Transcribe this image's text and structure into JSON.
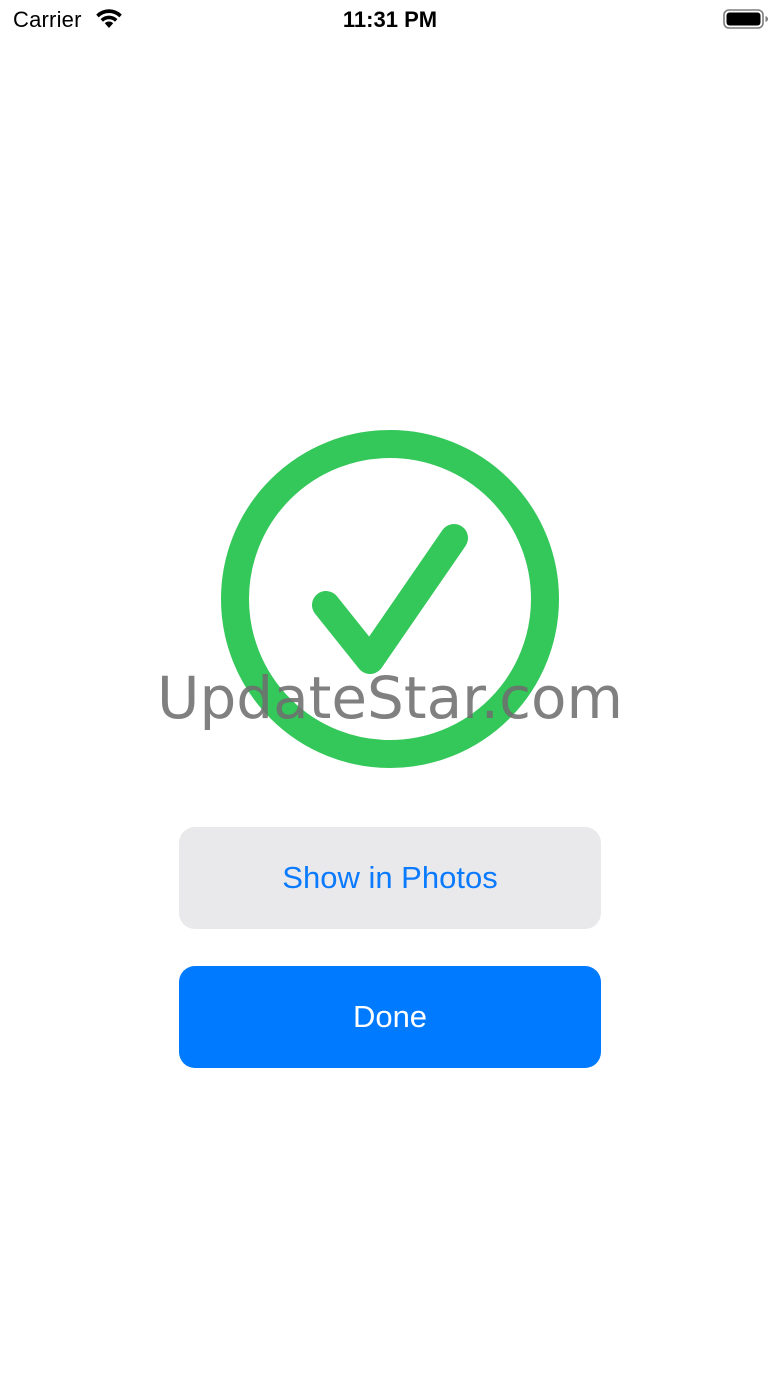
{
  "status_bar": {
    "carrier": "Carrier",
    "time": "11:31 PM",
    "icons": [
      "wifi-icon",
      "battery-icon"
    ]
  },
  "success": {
    "icon": "checkmark-circle-icon",
    "color": "#34c759"
  },
  "watermark": {
    "text": "UpdateStar.com"
  },
  "buttons": {
    "show_in_photos": "Show in Photos",
    "done": "Done"
  },
  "colors": {
    "accent": "#007aff",
    "secondary_bg": "#e9e9eb",
    "success": "#34c759"
  }
}
